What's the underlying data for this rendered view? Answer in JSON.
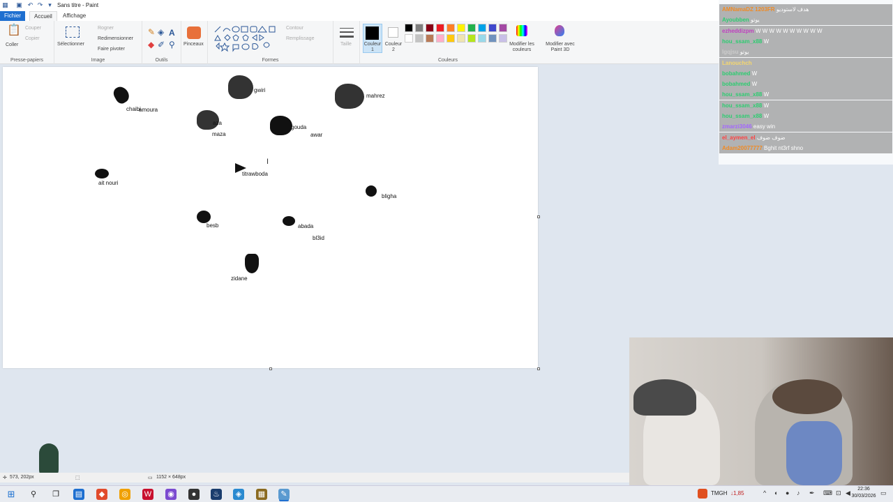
{
  "window": {
    "title": "Sans titre - Paint"
  },
  "tabs": [
    "Fichier",
    "Accueil",
    "Affichage"
  ],
  "ribbon": {
    "clipboard": {
      "paste": "Coller",
      "cut": "Couper",
      "copy": "Copier",
      "label": "Presse-papiers"
    },
    "image": {
      "select": "Sélectionner",
      "crop": "Rogner",
      "resize": "Redimensionner",
      "rotate": "Faire pivoter",
      "label": "Image"
    },
    "tools": {
      "label": "Outils"
    },
    "brushes": {
      "label": "Pinceaux"
    },
    "shapes": {
      "outline": "Contour",
      "fill": "Remplissage",
      "label": "Formes"
    },
    "size": {
      "label": "Taille"
    },
    "colors": {
      "color1": "Couleur 1",
      "color2": "Couleur 2",
      "edit": "Modifier les couleurs",
      "paint3d": "Modifier avec Paint 3D",
      "label": "Couleurs",
      "palette": [
        "#000000",
        "#7f7f7f",
        "#880015",
        "#ed1c24",
        "#ff7f27",
        "#fff200",
        "#22b14c",
        "#00a2e8",
        "#3f48cc",
        "#a349a4",
        "#ffffff",
        "#c3c3c3",
        "#b97a57",
        "#ffaec9",
        "#ffc90e",
        "#efe4b0",
        "#b5e61d",
        "#99d9ea",
        "#7092be",
        "#c8bfe7"
      ]
    }
  },
  "canvas_labels": [
    {
      "id": "chaibi",
      "text": "chaibi"
    },
    {
      "id": "amoura",
      "text": "amoura"
    },
    {
      "id": "gwiri",
      "text": "gwiri"
    },
    {
      "id": "mahrez",
      "text": "mahrez"
    },
    {
      "id": "aza",
      "text": "aza"
    },
    {
      "id": "maza",
      "text": "maza"
    },
    {
      "id": "gouda",
      "text": "gouda"
    },
    {
      "id": "awar",
      "text": "awar"
    },
    {
      "id": "titrawboda",
      "text": "titrawboda"
    },
    {
      "id": "ait-nouri",
      "text": "ait nouri"
    },
    {
      "id": "bligha",
      "text": "bligha"
    },
    {
      "id": "besb",
      "text": "besb"
    },
    {
      "id": "abada",
      "text": "abada"
    },
    {
      "id": "bl3id",
      "text": "bl3id"
    },
    {
      "id": "zidane",
      "text": "zidane"
    }
  ],
  "statusbar": {
    "coords": "573, 202px",
    "size": "1152 × 648px"
  },
  "chat": [
    {
      "user": "AMNamaDZ 1203FR",
      "msg": "هدف لاستوديو",
      "color": "#f08a24"
    },
    {
      "user": "Ayoubben",
      "msg": "يوتو",
      "color": "#2ecc71"
    },
    {
      "user": "ezheddizpm",
      "msg": "W W W W W W W W W W",
      "color": "#c040c0"
    },
    {
      "user": "hou_ssam_x88",
      "msg": "W",
      "color": "#2ecc71"
    },
    {
      "user": "lgqjsu",
      "msg": "يوتو",
      "color": "#cccccc"
    },
    {
      "user": "Lanouchch",
      "msg": "",
      "color": "#f5d76e"
    },
    {
      "user": "bobahmed",
      "msg": "W",
      "color": "#2ecc71"
    },
    {
      "user": "bobahmed",
      "msg": "W",
      "color": "#2ecc71"
    },
    {
      "user": "hou_ssam_x88",
      "msg": "W",
      "color": "#2ecc71"
    },
    {
      "user": "hou_ssam_x88",
      "msg": "W",
      "color": "#2ecc71"
    },
    {
      "user": "hou_ssam_x88",
      "msg": "W",
      "color": "#2ecc71"
    },
    {
      "user": "zmarzi3046",
      "msg": "easy win",
      "color": "#a366ff"
    },
    {
      "user": "el_aymen_el",
      "msg": "ضوف ضوف",
      "color": "#ff4040"
    },
    {
      "user": "Adam20077777",
      "msg": "Bghit nt3rf shno",
      "color": "#f08a24"
    }
  ],
  "taskbar": {
    "tray_text": "TMGH",
    "tray_value": "↓1,85",
    "time": "22:36",
    "date": "30/03/2026"
  }
}
